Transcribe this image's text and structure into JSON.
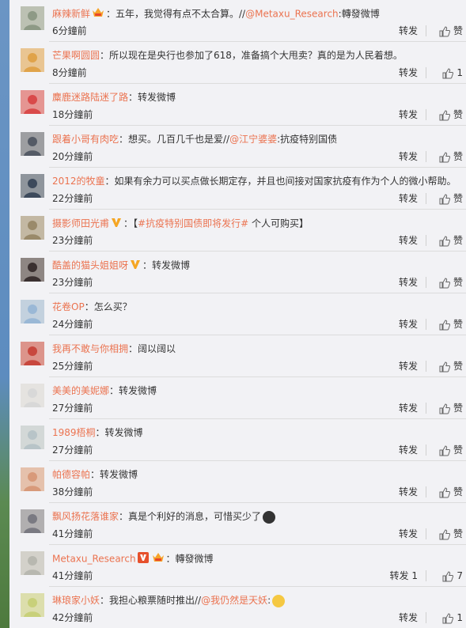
{
  "comments": [
    {
      "user": "麻辣新鲜",
      "badges": [
        "vip-crown"
      ],
      "pre": "：五年，我觉得有点不太合算。//",
      "mention": "@Metaxu_Research",
      "post": ":轉發微博",
      "time": "6分鐘前",
      "repost": "转发",
      "like": "赞",
      "avatar_color": "#8e9a86"
    },
    {
      "user": "芒果啊圆圆",
      "badges": [],
      "pre": "：所以现在是央行也参加了618，准备搞个大甩卖？真的是为人民着想。",
      "mention": "",
      "post": "",
      "time": "8分鐘前",
      "repost": "转发",
      "like": "1",
      "avatar_color": "#e0a34a"
    },
    {
      "user": "麋鹿迷路陆迷了路",
      "badges": [],
      "pre": "：转发微博",
      "mention": "",
      "post": "",
      "time": "18分鐘前",
      "repost": "转发",
      "like": "赞",
      "avatar_color": "#d94a4a"
    },
    {
      "user": "跟着小哥有肉吃",
      "badges": [],
      "pre": "：想买。几百几千也是爱//",
      "mention": "@江宁婆婆",
      "post": ":抗疫特别国债",
      "time": "20分鐘前",
      "repost": "转发",
      "like": "赞",
      "avatar_color": "#555b66"
    },
    {
      "user": "2012的牧童",
      "badges": [],
      "pre": "：如果有余力可以买点做长期定存，并且也间接对国家抗疫有作为个人的微小帮助。",
      "mention": "",
      "post": "",
      "time": "22分鐘前",
      "repost": "转发",
      "like": "赞",
      "avatar_color": "#3d4a5c"
    },
    {
      "user": "摄影师田光甫",
      "badges": [
        "v-gold"
      ],
      "pre": "：【",
      "hashtag": "#抗疫特别国债即将发行#",
      "post": " 个人可购买】",
      "mention": "",
      "time": "23分鐘前",
      "repost": "转发",
      "like": "赞",
      "avatar_color": "#9a8a6a"
    },
    {
      "user": "酷盖的猫头姐姐呀",
      "badges": [
        "v-gold"
      ],
      "pre": "：转发微博",
      "mention": "",
      "post": "",
      "time": "23分鐘前",
      "repost": "转发",
      "like": "赞",
      "avatar_color": "#3a3030"
    },
    {
      "user": "花卷OP",
      "badges": [],
      "pre": "：怎么买？",
      "mention": "",
      "post": "",
      "time": "24分鐘前",
      "repost": "转发",
      "like": "赞",
      "avatar_color": "#9ab8d6"
    },
    {
      "user": "我再不敢与你相拥",
      "badges": [],
      "pre": "：阔以阔以",
      "mention": "",
      "post": "",
      "time": "25分鐘前",
      "repost": "转发",
      "like": "赞",
      "avatar_color": "#c8483e"
    },
    {
      "user": "美美的美妮娜",
      "badges": [],
      "pre": "：转发微博",
      "mention": "",
      "post": "",
      "time": "27分鐘前",
      "repost": "转发",
      "like": "赞",
      "avatar_color": "#d8d8d8"
    },
    {
      "user": "1989梧桐",
      "badges": [],
      "pre": "：转发微博",
      "mention": "",
      "post": "",
      "time": "27分鐘前",
      "repost": "转发",
      "like": "赞",
      "avatar_color": "#b8c4c8"
    },
    {
      "user": "帕德容帕",
      "badges": [],
      "pre": "：转发微博",
      "mention": "",
      "post": "",
      "time": "38分鐘前",
      "repost": "转发",
      "like": "赞",
      "avatar_color": "#d89a7a"
    },
    {
      "user": "飘风扬花落谁家",
      "badges": [],
      "pre": "：真是个利好的消息，可惜买少了",
      "mention": "",
      "post": "",
      "emoji": "#333333",
      "time": "41分鐘前",
      "repost": "转发",
      "like": "赞",
      "avatar_color": "#7a7a82"
    },
    {
      "user": "Metaxu_Research",
      "badges": [
        "v-red",
        "vip-crown"
      ],
      "pre": "：轉發微博",
      "mention": "",
      "post": "",
      "time": "41分鐘前",
      "repost": "转发 1",
      "like": "7",
      "avatar_color": "#b8b8b0"
    },
    {
      "user": "琳琅家小妖",
      "badges": [],
      "pre": "：我担心粮票随时推出//",
      "mention": "@我仍然是天妖",
      "post": ":",
      "emoji": "#f5c842",
      "time": "42分鐘前",
      "repost": "转发",
      "like": "1",
      "avatar_color": "#c8d07a"
    }
  ]
}
